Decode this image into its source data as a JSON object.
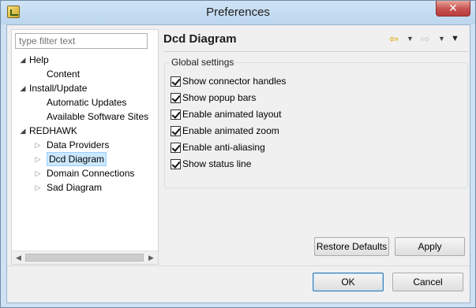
{
  "window": {
    "title": "Preferences",
    "close_glyph": "✕"
  },
  "filter": {
    "placeholder": "type filter text"
  },
  "tree": {
    "items": [
      {
        "label": "Help",
        "level": 0,
        "twisty": "expanded"
      },
      {
        "label": "Content",
        "level": 1,
        "twisty": "none"
      },
      {
        "label": "Install/Update",
        "level": 0,
        "twisty": "expanded"
      },
      {
        "label": "Automatic Updates",
        "level": 1,
        "twisty": "none"
      },
      {
        "label": "Available Software Sites",
        "level": 1,
        "twisty": "none"
      },
      {
        "label": "REDHAWK",
        "level": 0,
        "twisty": "expanded"
      },
      {
        "label": "Data Providers",
        "level": 1,
        "twisty": "collapsed"
      },
      {
        "label": "Dcd Diagram",
        "level": 1,
        "twisty": "collapsed",
        "selected": true
      },
      {
        "label": "Domain Connections",
        "level": 1,
        "twisty": "collapsed"
      },
      {
        "label": "Sad Diagram",
        "level": 1,
        "twisty": "collapsed"
      }
    ]
  },
  "page": {
    "title": "Dcd Diagram",
    "group_title": "Global settings",
    "settings": [
      {
        "label": "Show connector handles",
        "checked": true
      },
      {
        "label": "Show popup bars",
        "checked": true
      },
      {
        "label": "Enable animated layout",
        "checked": true
      },
      {
        "label": "Enable animated zoom",
        "checked": true
      },
      {
        "label": "Enable anti-aliasing",
        "checked": true
      },
      {
        "label": "Show status line",
        "checked": true
      }
    ],
    "restore_defaults_label": "Restore Defaults",
    "apply_label": "Apply"
  },
  "footer": {
    "ok_label": "OK",
    "cancel_label": "Cancel"
  },
  "icons": {
    "back": "back-arrow-icon",
    "forward": "forward-arrow-icon",
    "view_menu": "view-menu-icon"
  },
  "colors": {
    "selection_bg": "#cce8ff",
    "selection_border": "#99d1ff",
    "back_arrow": "#e0a800",
    "close_button": "#c75050"
  }
}
